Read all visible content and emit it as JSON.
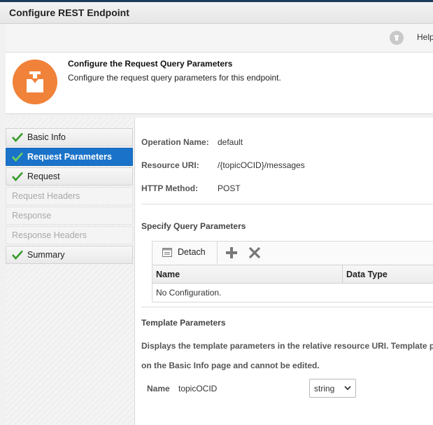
{
  "window": {
    "title": "Configure REST Endpoint"
  },
  "toolbar": {
    "help_label": "Help"
  },
  "header": {
    "title": "Configure the Request Query Parameters",
    "subtitle": "Configure the request query parameters for this endpoint."
  },
  "nav": {
    "items": [
      {
        "label": "Basic Info",
        "state": "complete"
      },
      {
        "label": "Request Parameters",
        "state": "active"
      },
      {
        "label": "Request",
        "state": "complete"
      },
      {
        "label": "Request Headers",
        "state": "disabled"
      },
      {
        "label": "Response",
        "state": "disabled"
      },
      {
        "label": "Response Headers",
        "state": "disabled"
      },
      {
        "label": "Summary",
        "state": "complete"
      }
    ]
  },
  "details": {
    "operation_name_label": "Operation Name:",
    "operation_name_value": "default",
    "resource_uri_label": "Resource URI:",
    "resource_uri_value": "/{topicOCID}/messages",
    "http_method_label": "HTTP Method:",
    "http_method_value": "POST"
  },
  "query_params": {
    "section_title": "Specify Query Parameters",
    "detach_label": "Detach",
    "columns": [
      "Name",
      "Data Type"
    ],
    "empty_text": "No Configuration."
  },
  "template_params": {
    "section_title": "Template Parameters",
    "description_line1": "Displays the template parameters in the relative resource URI. Template p",
    "description_line2": "on the Basic Info page and cannot be edited.",
    "name_label": "Name",
    "name_value": "topicOCID",
    "type_value": "string"
  },
  "colors": {
    "accent": "#1a73c8",
    "check": "#3a9a2c",
    "header_icon": "#f0823a"
  }
}
